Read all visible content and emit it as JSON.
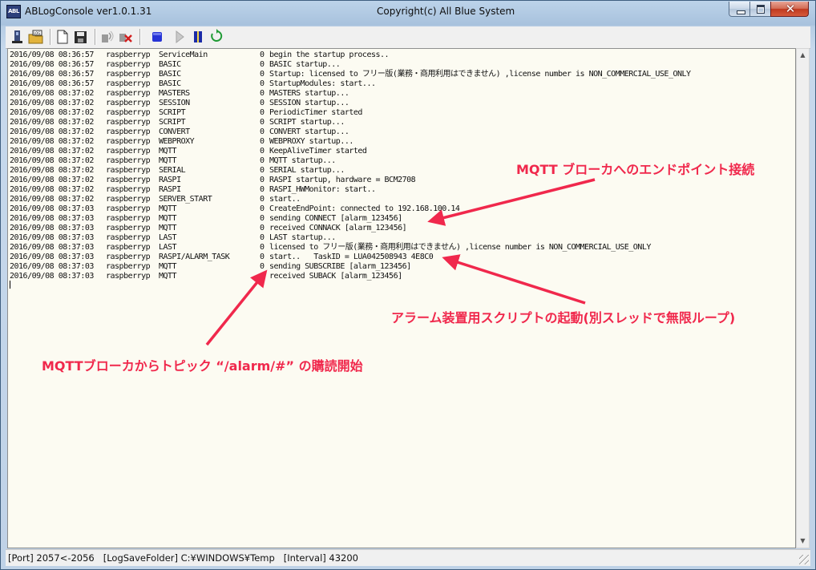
{
  "window": {
    "title": "ABLogConsole ver1.0.1.31",
    "copyright": "Copyright(c) All Blue System",
    "icon_text": "ABL"
  },
  "toolbar": {
    "buttons": [
      {
        "icon": "connect-icon"
      },
      {
        "icon": "log-folder-icon"
      },
      {
        "icon": "new-document-icon"
      },
      {
        "icon": "save-icon"
      },
      {
        "icon": "connect-device-icon"
      },
      {
        "icon": "disconnect-device-icon"
      },
      {
        "icon": "stop-icon"
      },
      {
        "icon": "play-icon"
      },
      {
        "icon": "pause-icon"
      },
      {
        "icon": "refresh-icon"
      }
    ]
  },
  "log": [
    {
      "date": "2016/09/08 08:36:57",
      "host": "raspberryp",
      "module": "ServiceMain",
      "level": "0",
      "message": "begin the startup process.."
    },
    {
      "date": "2016/09/08 08:36:57",
      "host": "raspberryp",
      "module": "BASIC",
      "level": "0",
      "message": "BASIC startup..."
    },
    {
      "date": "2016/09/08 08:36:57",
      "host": "raspberryp",
      "module": "BASIC",
      "level": "0",
      "message": "Startup: licensed to フリー版(業務・商用利用はできません) ,license number is NON_COMMERCIAL_USE_ONLY"
    },
    {
      "date": "2016/09/08 08:36:57",
      "host": "raspberryp",
      "module": "BASIC",
      "level": "0",
      "message": "StartupModules: start..."
    },
    {
      "date": "2016/09/08 08:37:02",
      "host": "raspberryp",
      "module": "MASTERS",
      "level": "0",
      "message": "MASTERS startup..."
    },
    {
      "date": "2016/09/08 08:37:02",
      "host": "raspberryp",
      "module": "SESSION",
      "level": "0",
      "message": "SESSION startup..."
    },
    {
      "date": "2016/09/08 08:37:02",
      "host": "raspberryp",
      "module": "SCRIPT",
      "level": "0",
      "message": "PeriodicTimer started"
    },
    {
      "date": "2016/09/08 08:37:02",
      "host": "raspberryp",
      "module": "SCRIPT",
      "level": "0",
      "message": "SCRIPT startup..."
    },
    {
      "date": "2016/09/08 08:37:02",
      "host": "raspberryp",
      "module": "CONVERT",
      "level": "0",
      "message": "CONVERT startup..."
    },
    {
      "date": "2016/09/08 08:37:02",
      "host": "raspberryp",
      "module": "WEBPROXY",
      "level": "0",
      "message": "WEBPROXY startup..."
    },
    {
      "date": "2016/09/08 08:37:02",
      "host": "raspberryp",
      "module": "MQTT",
      "level": "0",
      "message": "KeepAliveTimer started"
    },
    {
      "date": "2016/09/08 08:37:02",
      "host": "raspberryp",
      "module": "MQTT",
      "level": "0",
      "message": "MQTT startup..."
    },
    {
      "date": "2016/09/08 08:37:02",
      "host": "raspberryp",
      "module": "SERIAL",
      "level": "0",
      "message": "SERIAL startup..."
    },
    {
      "date": "2016/09/08 08:37:02",
      "host": "raspberryp",
      "module": "RASPI",
      "level": "0",
      "message": "RASPI startup, hardware = BCM2708"
    },
    {
      "date": "2016/09/08 08:37:02",
      "host": "raspberryp",
      "module": "RASPI",
      "level": "0",
      "message": "RASPI_HWMonitor: start.."
    },
    {
      "date": "2016/09/08 08:37:02",
      "host": "raspberryp",
      "module": "SERVER_START",
      "level": "0",
      "message": "start.."
    },
    {
      "date": "2016/09/08 08:37:03",
      "host": "raspberryp",
      "module": "MQTT",
      "level": "0",
      "message": "CreateEndPoint: connected to 192.168.100.14"
    },
    {
      "date": "2016/09/08 08:37:03",
      "host": "raspberryp",
      "module": "MQTT",
      "level": "0",
      "message": "sending CONNECT [alarm_123456]"
    },
    {
      "date": "2016/09/08 08:37:03",
      "host": "raspberryp",
      "module": "MQTT",
      "level": "0",
      "message": "received CONNACK [alarm_123456]"
    },
    {
      "date": "2016/09/08 08:37:03",
      "host": "raspberryp",
      "module": "LAST",
      "level": "0",
      "message": "LAST startup..."
    },
    {
      "date": "2016/09/08 08:37:03",
      "host": "raspberryp",
      "module": "LAST",
      "level": "0",
      "message": "licensed to フリー版(業務・商用利用はできません) ,license number is NON_COMMERCIAL_USE_ONLY"
    },
    {
      "date": "2016/09/08 08:37:03",
      "host": "raspberryp",
      "module": "RASPI/ALARM_TASK",
      "level": "0",
      "message": "start..   TaskID = LUA042508943 4E8C0"
    },
    {
      "date": "2016/09/08 08:37:03",
      "host": "raspberryp",
      "module": "MQTT",
      "level": "0",
      "message": "sending SUBSCRIBE [alarm_123456]"
    },
    {
      "date": "2016/09/08 08:37:03",
      "host": "raspberryp",
      "module": "MQTT",
      "level": "0",
      "message": "received SUBACK [alarm_123456]"
    }
  ],
  "annotations": {
    "endpoint": "MQTT ブローカへのエンドポイント接続",
    "script": "アラーム装置用スクリプトの起動(別スレッドで無限ループ)",
    "subscribe": "MQTTブローカからトピック “/alarm/#” の購読開始",
    "color": "#f0284c"
  },
  "status": {
    "text": "[Port] 2057<-2056   [LogSaveFolder] C:¥WINDOWS¥Temp   [Interval] 43200"
  }
}
